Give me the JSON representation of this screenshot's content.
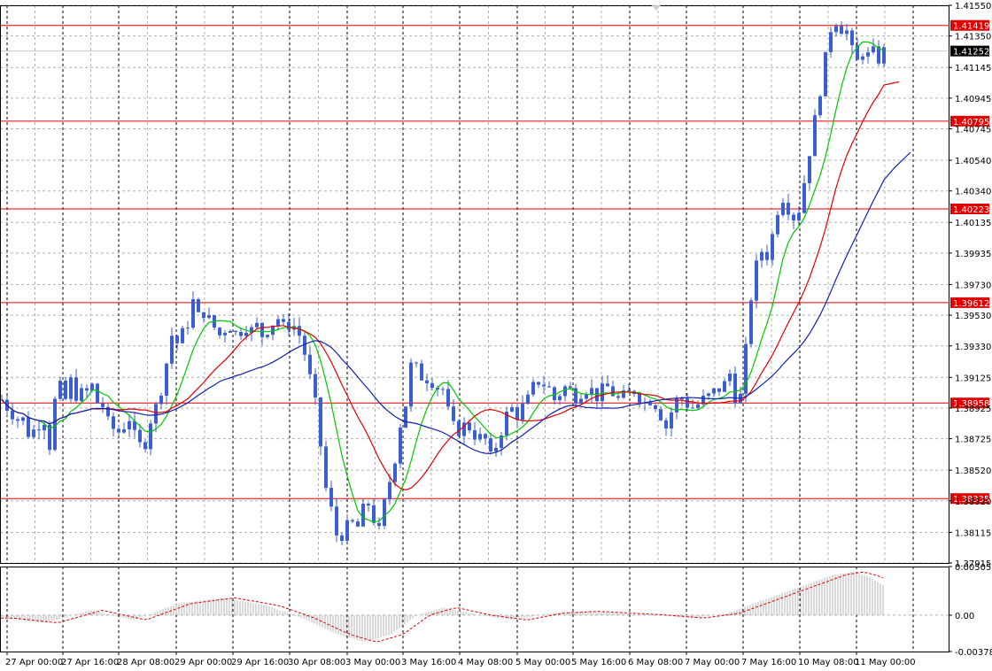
{
  "chart_data": {
    "type": "candlestick",
    "y_range": [
      1.37915,
      1.4155
    ],
    "osc_range": [
      -0.00378,
      0.005055
    ],
    "price_ticks": [
      "1.41550",
      "1.41350",
      "1.41145",
      "1.40945",
      "1.40745",
      "1.40540",
      "1.40340",
      "1.40135",
      "1.39935",
      "1.39730",
      "1.39530",
      "1.39330",
      "1.39125",
      "1.38925",
      "1.38725",
      "1.38520",
      "1.38320",
      "1.38115",
      "1.37915"
    ],
    "osc_ticks": [
      "0.005055",
      "0.00",
      "-0.00378"
    ],
    "time_labels": [
      "27 Apr 00:00",
      "27 Apr 16:00",
      "28 Apr 08:00",
      "29 Apr 00:00",
      "29 Apr 16:00",
      "30 Apr 08:00",
      "3 May 00:00",
      "3 May 16:00",
      "4 May 08:00",
      "5 May 00:00",
      "5 May 16:00",
      "6 May 08:00",
      "7 May 00:00",
      "7 May 16:00",
      "10 May 08:00",
      "11 May 00:00"
    ],
    "levels": [
      {
        "price": 1.41419,
        "label": "1.41419"
      },
      {
        "price": 1.40795,
        "label": "1.40795"
      },
      {
        "price": 1.40223,
        "label": "1.40223"
      },
      {
        "price": 1.39612,
        "label": "1.39612"
      },
      {
        "price": 1.38958,
        "label": "1.38958"
      },
      {
        "price": 1.38335,
        "label": "1.38335"
      }
    ],
    "current_price": {
      "price": 1.41252,
      "label": "1.41252"
    },
    "colors": {
      "candle": "#3b5fd0",
      "level": "#e00000",
      "current_tag": "#000000",
      "ma_fast": "#00c800",
      "ma_mid": "#e00000",
      "ma_slow": "#1020b0",
      "histogram": "#b4b4b4",
      "signal": "#e00000",
      "grid": "#b0b0b0"
    },
    "price_path": [
      [
        0,
        1.3898
      ],
      [
        6,
        1.3893
      ],
      [
        12,
        1.3889
      ],
      [
        18,
        1.3885
      ],
      [
        24,
        1.3885
      ],
      [
        30,
        1.3876
      ],
      [
        36,
        1.3878
      ],
      [
        42,
        1.3882
      ],
      [
        48,
        1.3885
      ],
      [
        54,
        1.3868
      ],
      [
        60,
        1.3897
      ],
      [
        66,
        1.3906
      ],
      [
        72,
        1.3898
      ],
      [
        78,
        1.391
      ],
      [
        84,
        1.3901
      ],
      [
        90,
        1.3902
      ],
      [
        96,
        1.3903
      ],
      [
        102,
        1.3907
      ],
      [
        108,
        1.3896
      ],
      [
        114,
        1.3894
      ],
      [
        120,
        1.3883
      ],
      [
        126,
        1.3879
      ],
      [
        132,
        1.3877
      ],
      [
        138,
        1.3881
      ],
      [
        144,
        1.3886
      ],
      [
        150,
        1.3874
      ],
      [
        156,
        1.3868
      ],
      [
        162,
        1.387
      ],
      [
        168,
        1.3885
      ],
      [
        174,
        1.3893
      ],
      [
        180,
        1.3905
      ],
      [
        186,
        1.3922
      ],
      [
        192,
        1.394
      ],
      [
        198,
        1.3935
      ],
      [
        204,
        1.3941
      ],
      [
        210,
        1.3948
      ],
      [
        216,
        1.3962
      ],
      [
        222,
        1.3952
      ],
      [
        228,
        1.3955
      ],
      [
        234,
        1.395
      ],
      [
        240,
        1.3945
      ],
      [
        246,
        1.394
      ],
      [
        252,
        1.3944
      ],
      [
        258,
        1.3946
      ],
      [
        264,
        1.3941
      ],
      [
        270,
        1.3943
      ],
      [
        276,
        1.3946
      ],
      [
        282,
        1.3943
      ],
      [
        288,
        1.3946
      ],
      [
        294,
        1.394
      ],
      [
        300,
        1.3944
      ],
      [
        306,
        1.3948
      ],
      [
        312,
        1.3951
      ],
      [
        318,
        1.3945
      ],
      [
        324,
        1.3947
      ],
      [
        330,
        1.3946
      ],
      [
        336,
        1.394
      ],
      [
        342,
        1.3928
      ],
      [
        348,
        1.3912
      ],
      [
        354,
        1.3895
      ],
      [
        360,
        1.3868
      ],
      [
        366,
        1.384
      ],
      [
        372,
        1.3826
      ],
      [
        378,
        1.381
      ],
      [
        384,
        1.381
      ],
      [
        390,
        1.3815
      ],
      [
        396,
        1.3817
      ],
      [
        402,
        1.3815
      ],
      [
        408,
        1.3826
      ],
      [
        414,
        1.383
      ],
      [
        420,
        1.382
      ],
      [
        426,
        1.3812
      ],
      [
        432,
        1.383
      ],
      [
        438,
        1.3845
      ],
      [
        444,
        1.386
      ],
      [
        450,
        1.3882
      ],
      [
        456,
        1.3895
      ],
      [
        462,
        1.392
      ],
      [
        468,
        1.3918
      ],
      [
        474,
        1.3913
      ],
      [
        480,
        1.3912
      ],
      [
        486,
        1.391
      ],
      [
        492,
        1.3906
      ],
      [
        498,
        1.3905
      ],
      [
        504,
        1.389
      ],
      [
        510,
        1.388
      ],
      [
        516,
        1.3878
      ],
      [
        522,
        1.3881
      ],
      [
        528,
        1.388
      ],
      [
        534,
        1.3875
      ],
      [
        540,
        1.3873
      ],
      [
        546,
        1.3872
      ],
      [
        552,
        1.386
      ],
      [
        558,
        1.3868
      ],
      [
        564,
        1.3878
      ],
      [
        570,
        1.3888
      ],
      [
        576,
        1.3892
      ],
      [
        582,
        1.3888
      ],
      [
        588,
        1.3893
      ],
      [
        594,
        1.3898
      ],
      [
        600,
        1.3906
      ],
      [
        606,
        1.391
      ],
      [
        612,
        1.3908
      ],
      [
        618,
        1.3905
      ],
      [
        624,
        1.3898
      ],
      [
        630,
        1.3902
      ],
      [
        636,
        1.3906
      ],
      [
        642,
        1.3904
      ],
      [
        648,
        1.39
      ],
      [
        654,
        1.3903
      ],
      [
        660,
        1.3905
      ],
      [
        666,
        1.3904
      ],
      [
        672,
        1.39
      ],
      [
        678,
        1.3904
      ],
      [
        684,
        1.3906
      ],
      [
        690,
        1.3902
      ],
      [
        696,
        1.3898
      ],
      [
        702,
        1.39
      ],
      [
        708,
        1.3902
      ],
      [
        714,
        1.3904
      ],
      [
        720,
        1.39
      ],
      [
        726,
        1.3896
      ],
      [
        732,
        1.3898
      ],
      [
        738,
        1.3895
      ],
      [
        744,
        1.3888
      ],
      [
        750,
        1.388
      ],
      [
        756,
        1.389
      ],
      [
        762,
        1.3897
      ],
      [
        768,
        1.3899
      ],
      [
        774,
        1.3895
      ],
      [
        780,
        1.3893
      ],
      [
        786,
        1.3895
      ],
      [
        792,
        1.3898
      ],
      [
        798,
        1.39
      ],
      [
        804,
        1.3903
      ],
      [
        810,
        1.3905
      ],
      [
        816,
        1.3908
      ],
      [
        822,
        1.3915
      ],
      [
        828,
        1.39
      ],
      [
        834,
        1.39
      ],
      [
        840,
        1.393
      ],
      [
        846,
        1.3965
      ],
      [
        852,
        1.3985
      ],
      [
        858,
        1.3995
      ],
      [
        864,
        1.3992
      ],
      [
        870,
        1.4005
      ],
      [
        876,
        1.4022
      ],
      [
        882,
        1.403
      ],
      [
        888,
        1.4023
      ],
      [
        894,
        1.4017
      ],
      [
        900,
        1.4022
      ],
      [
        906,
        1.404
      ],
      [
        912,
        1.406
      ],
      [
        918,
        1.408
      ],
      [
        924,
        1.41
      ],
      [
        930,
        1.412
      ],
      [
        936,
        1.414
      ],
      [
        942,
        1.4145
      ],
      [
        948,
        1.414
      ],
      [
        954,
        1.4138
      ],
      [
        960,
        1.4125
      ],
      [
        966,
        1.4118
      ],
      [
        972,
        1.4125
      ],
      [
        978,
        1.4122
      ],
      [
        984,
        1.4124
      ],
      [
        990,
        1.412
      ],
      [
        996,
        1.4125
      ]
    ],
    "oscillator_path": [
      [
        0,
        -0.0003
      ],
      [
        50,
        -0.0008
      ],
      [
        100,
        0.0005
      ],
      [
        150,
        -0.0005
      ],
      [
        200,
        0.0012
      ],
      [
        250,
        0.0018
      ],
      [
        300,
        0.001
      ],
      [
        340,
        -0.0003
      ],
      [
        380,
        -0.002
      ],
      [
        410,
        -0.0028
      ],
      [
        440,
        -0.002
      ],
      [
        470,
        0.0
      ],
      [
        500,
        0.0008
      ],
      [
        540,
        0.0
      ],
      [
        580,
        -0.0005
      ],
      [
        620,
        0.0002
      ],
      [
        660,
        0.0004
      ],
      [
        700,
        0.0002
      ],
      [
        740,
        0.0
      ],
      [
        780,
        -0.0003
      ],
      [
        820,
        0.0002
      ],
      [
        850,
        0.0012
      ],
      [
        880,
        0.0022
      ],
      [
        910,
        0.0032
      ],
      [
        940,
        0.0042
      ],
      [
        960,
        0.0045
      ],
      [
        980,
        0.004
      ],
      [
        998,
        0.003
      ]
    ]
  }
}
